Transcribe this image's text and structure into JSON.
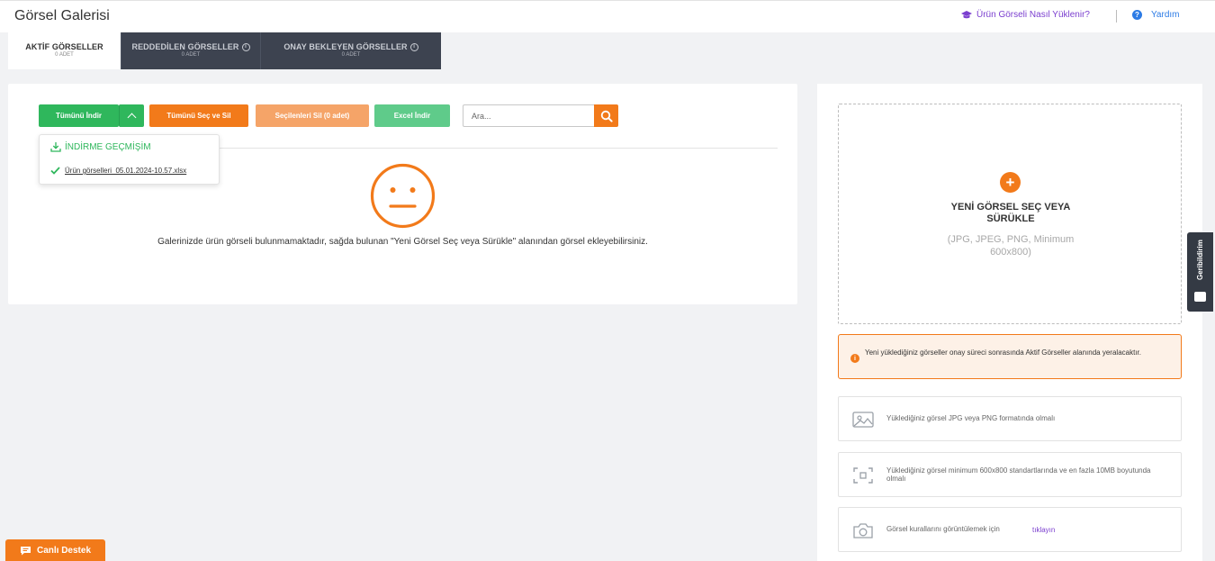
{
  "header": {
    "title": "Görsel Galerisi",
    "howto_link": "Ürün Görseli Nasıl Yüklenir?",
    "help_link": "Yardım"
  },
  "tabs": [
    {
      "label": "AKTİF GÖRSELLER",
      "count": "0 ADET",
      "active": true
    },
    {
      "label": "REDDEDİLEN GÖRSELLER",
      "count": "0 ADET",
      "active": false
    },
    {
      "label": "ONAY BEKLEYEN GÖRSELLER",
      "count": "0 ADET",
      "active": false
    }
  ],
  "toolbar": {
    "download_all": "Tümünü İndir",
    "select_all_delete": "Tümünü Seç ve Sil",
    "delete_selected": "Seçilenleri Sil (0 adet)",
    "excel_download": "Excel İndir",
    "search_placeholder": "Ara..."
  },
  "download_menu": {
    "history_label": "İNDİRME GEÇMİŞİM",
    "file_name": "Ürün görselleri_05.01.2024-10.57.xlsx"
  },
  "empty_state": {
    "message": "Galerinizde ürün görseli bulunmamaktadır, sağda bulunan \"Yeni Görsel Seç veya Sürükle\" alanından görsel ekleyebilirsiniz."
  },
  "upload": {
    "title_line1": "YENİ GÖRSEL SEÇ VEYA",
    "title_line2": "SÜRÜKLE",
    "sub_line1": "(JPG, JPEG, PNG, Minimum",
    "sub_line2": "600x800)"
  },
  "notice": {
    "text": "Yeni yüklediğiniz görseller onay süreci sonrasında Aktif Görseller alanında yeralacaktır."
  },
  "rules": [
    {
      "text": "Yüklediğiniz görsel JPG veya PNG formatında olmalı",
      "icon": "image-icon"
    },
    {
      "text": "Yüklediğiniz görsel minimum 600x800 standartlarında ve en fazla 10MB boyutunda olmalı",
      "icon": "frame-icon"
    },
    {
      "text": "Görsel kurallarını görüntülemek için",
      "link": "tıklayın",
      "icon": "camera-icon"
    }
  ],
  "feedback_label": "Geribildirim",
  "live_support": "Canlı Destek",
  "colors": {
    "orange": "#f27a1a",
    "green": "#2fb75c",
    "purple": "#7b3fcf",
    "blue": "#2c7be5",
    "dark_tab": "#3d4350"
  }
}
